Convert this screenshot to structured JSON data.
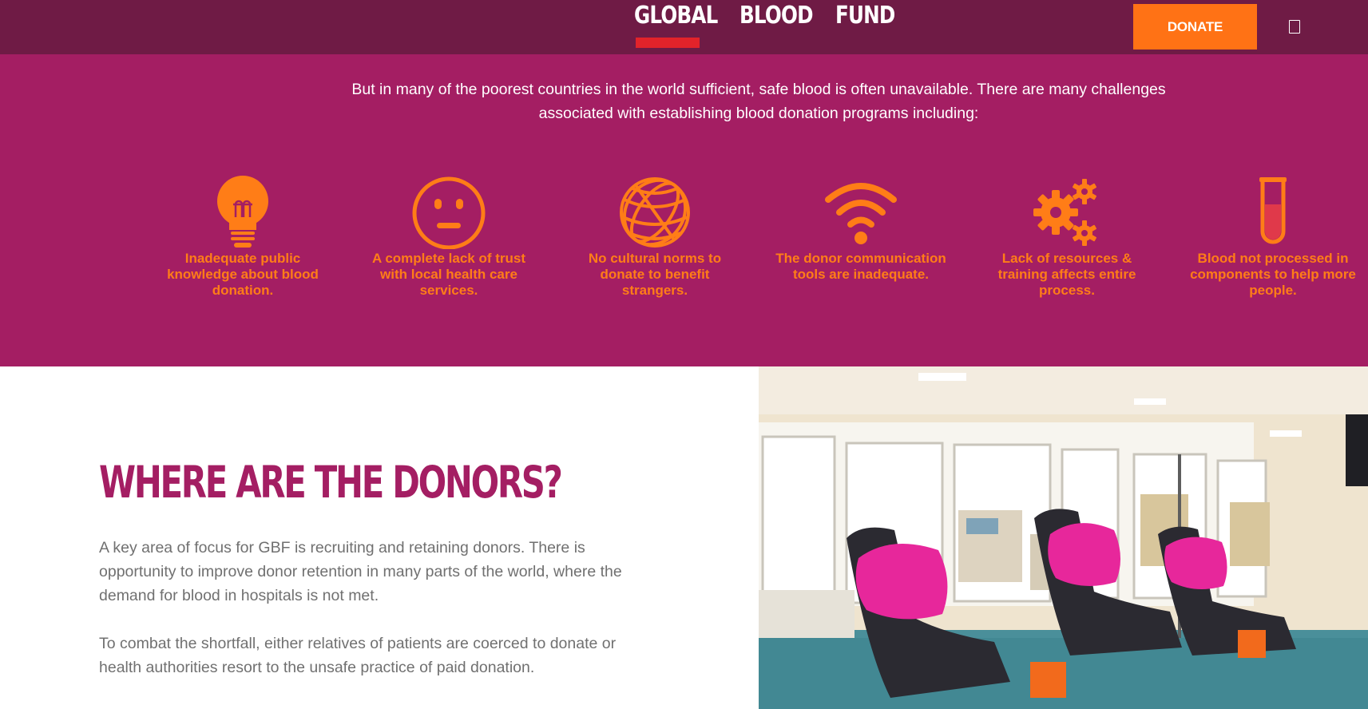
{
  "header": {
    "logo_words": [
      "GLOBAL",
      "BLOOD",
      "FUND"
    ],
    "donate_label": "DONATE",
    "menu_icon": "menu-icon"
  },
  "challenges": {
    "intro": "But in many of the poorest countries in the world sufficient, safe blood is often unavailable. There are many challenges associated with establishing blood donation programs including:",
    "items": [
      {
        "icon": "lightbulb-icon",
        "label": "Inadequate public knowledge about blood donation."
      },
      {
        "icon": "neutral-face-icon",
        "label": "A complete lack of trust with local health care services."
      },
      {
        "icon": "globe-icon",
        "label": "No cultural norms to donate to benefit strangers."
      },
      {
        "icon": "wifi-icon",
        "label": "The donor communication tools are inadequate."
      },
      {
        "icon": "gears-icon",
        "label": "Lack of resources & training affects entire process."
      },
      {
        "icon": "test-tube-icon",
        "label": "Blood not processed in components to help more people."
      }
    ]
  },
  "donors": {
    "title": "WHERE ARE THE DONORS?",
    "paragraphs": [
      "A key area of focus for GBF is recruiting and retaining donors. There is opportunity to improve donor retention in many parts of the world, where the demand for blood in hospitals is not met.",
      "To combat the shortfall, either relatives of patients are coerced to donate or health authorities resort to the unsafe practice of paid donation."
    ]
  },
  "colors": {
    "header_bg": "#6f1b45",
    "section_bg": "#a41e63",
    "accent_orange": "#ff7215",
    "logo_underline": "#e2232a",
    "title_color": "#a41e63",
    "body_text": "#707070"
  }
}
